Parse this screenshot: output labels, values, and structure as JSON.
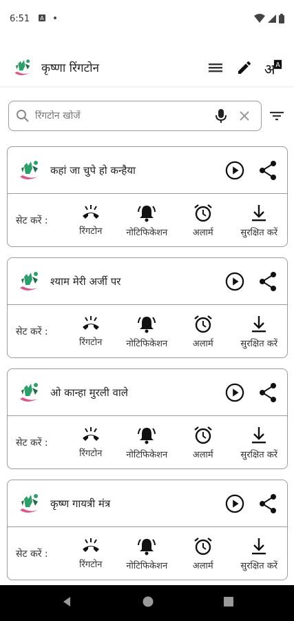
{
  "status": {
    "time": "6:51"
  },
  "app": {
    "title": "कृष्णा रिंगटोन"
  },
  "search": {
    "placeholder": "रिंगटोन खोजें"
  },
  "card_labels": {
    "set_label": "सेट करें :",
    "ringtone": "रिंगटोन",
    "notification": "नोटिफिकेशन",
    "alarm": "अलार्म",
    "save": "सुरक्षित करें"
  },
  "ringtones": [
    {
      "title": "कहां जा चुपे हो कन्हैया"
    },
    {
      "title": "श्याम मेरी अर्जी पर"
    },
    {
      "title": "ओ कान्हा मुरली वाले"
    },
    {
      "title": "कृष्ण गायत्री मंत्र"
    }
  ],
  "colors": {
    "icon": "#1a1a1a",
    "border": "#9a9a9a",
    "logo_green": "#2e9e6a",
    "logo_pink": "#d85a8a"
  }
}
